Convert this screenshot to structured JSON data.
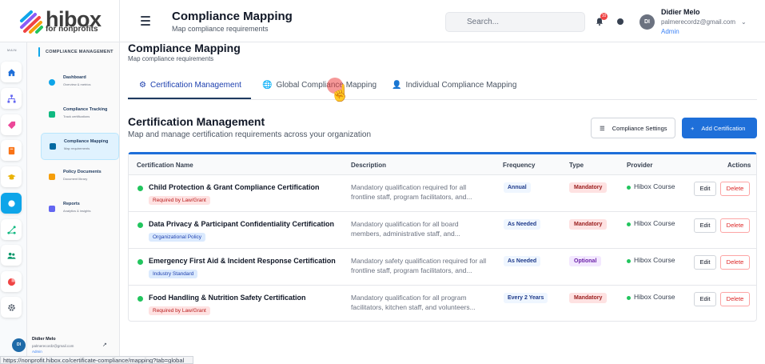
{
  "app": {
    "logo_text": "hibox",
    "logo_sub": "for nonprofits"
  },
  "header": {
    "title": "Compliance Mapping",
    "subtitle": "Map compliance requirements",
    "search_placeholder": "Search...",
    "notification_count": "10",
    "user": {
      "initials": "DI",
      "name": "Didier Melo",
      "email": "palmerecordz@gmail.com",
      "role": "Admin"
    }
  },
  "sidebar": {
    "main_label": "MAIN",
    "panel_title": "COMPLIANCE MANAGEMENT",
    "items": [
      {
        "title": "Dashboard",
        "sub": "Overview & metrics",
        "icon": "dashboard-icon",
        "color": "#0ea5e9"
      },
      {
        "title": "Compliance Tracking",
        "sub": "Track certifications",
        "icon": "shield-check-icon",
        "color": "#10b981"
      },
      {
        "title": "Compliance Mapping",
        "sub": "Map requirements",
        "icon": "mapping-icon",
        "color": "#0369a1",
        "active": true
      },
      {
        "title": "Policy Documents",
        "sub": "Document library",
        "icon": "folder-icon",
        "color": "#f59e0b"
      },
      {
        "title": "Reports",
        "sub": "Analytics & insights",
        "icon": "bar-chart-icon",
        "color": "#6366f1"
      }
    ],
    "user": {
      "initials": "DI",
      "name": "Didier Melo",
      "email": "palmerecordz@gmail.com",
      "role": "Admin"
    }
  },
  "page": {
    "title": "Compliance Mapping",
    "subtitle": "Map compliance requirements"
  },
  "tabs": [
    {
      "label": "Certification Management",
      "icon": "gear-icon",
      "active": true
    },
    {
      "label": "Global Compliance Mapping",
      "icon": "globe-icon"
    },
    {
      "label": "Individual Compliance Mapping",
      "icon": "user-check-icon"
    }
  ],
  "section": {
    "title": "Certification Management",
    "subtitle": "Map and manage certification requirements across your organization",
    "settings_button": "Compliance Settings",
    "add_button": "Add Certification"
  },
  "table": {
    "columns": [
      "Certification Name",
      "Description",
      "Frequency",
      "Type",
      "Provider",
      "Actions"
    ],
    "rows": [
      {
        "name": "Child Protection & Grant Compliance Certification",
        "tag": "Required by Law/Grant",
        "description": "Mandatory qualification required for all frontline staff, program facilitators, and...",
        "frequency": "Annual",
        "type": "Mandatory",
        "provider": "Hibox Course"
      },
      {
        "name": "Data Privacy & Participant Confidentiality Certification",
        "tag": "Organizational Policy",
        "description": "Mandatory qualification for all board members, administrative staff, and...",
        "frequency": "As Needed",
        "type": "Mandatory",
        "provider": "Hibox Course"
      },
      {
        "name": "Emergency First Aid & Incident Response Certification",
        "tag": "Industry Standard",
        "description": "Mandatory safety qualification required for all frontline staff, program facilitators, and...",
        "frequency": "As Needed",
        "type": "Optional",
        "provider": "Hibox Course"
      },
      {
        "name": "Food Handling & Nutrition Safety Certification",
        "tag": "Required by Law/Grant",
        "description": "Mandatory qualification for all program facilitators, kitchen staff, and volunteers...",
        "frequency": "Every 2 Years",
        "type": "Mandatory",
        "provider": "Hibox Course"
      }
    ],
    "edit_label": "Edit",
    "delete_label": "Delete"
  },
  "status_bar": {
    "url": "https://nonprofit.hibox.co/certificate-compliance/mapping?tab=global"
  }
}
